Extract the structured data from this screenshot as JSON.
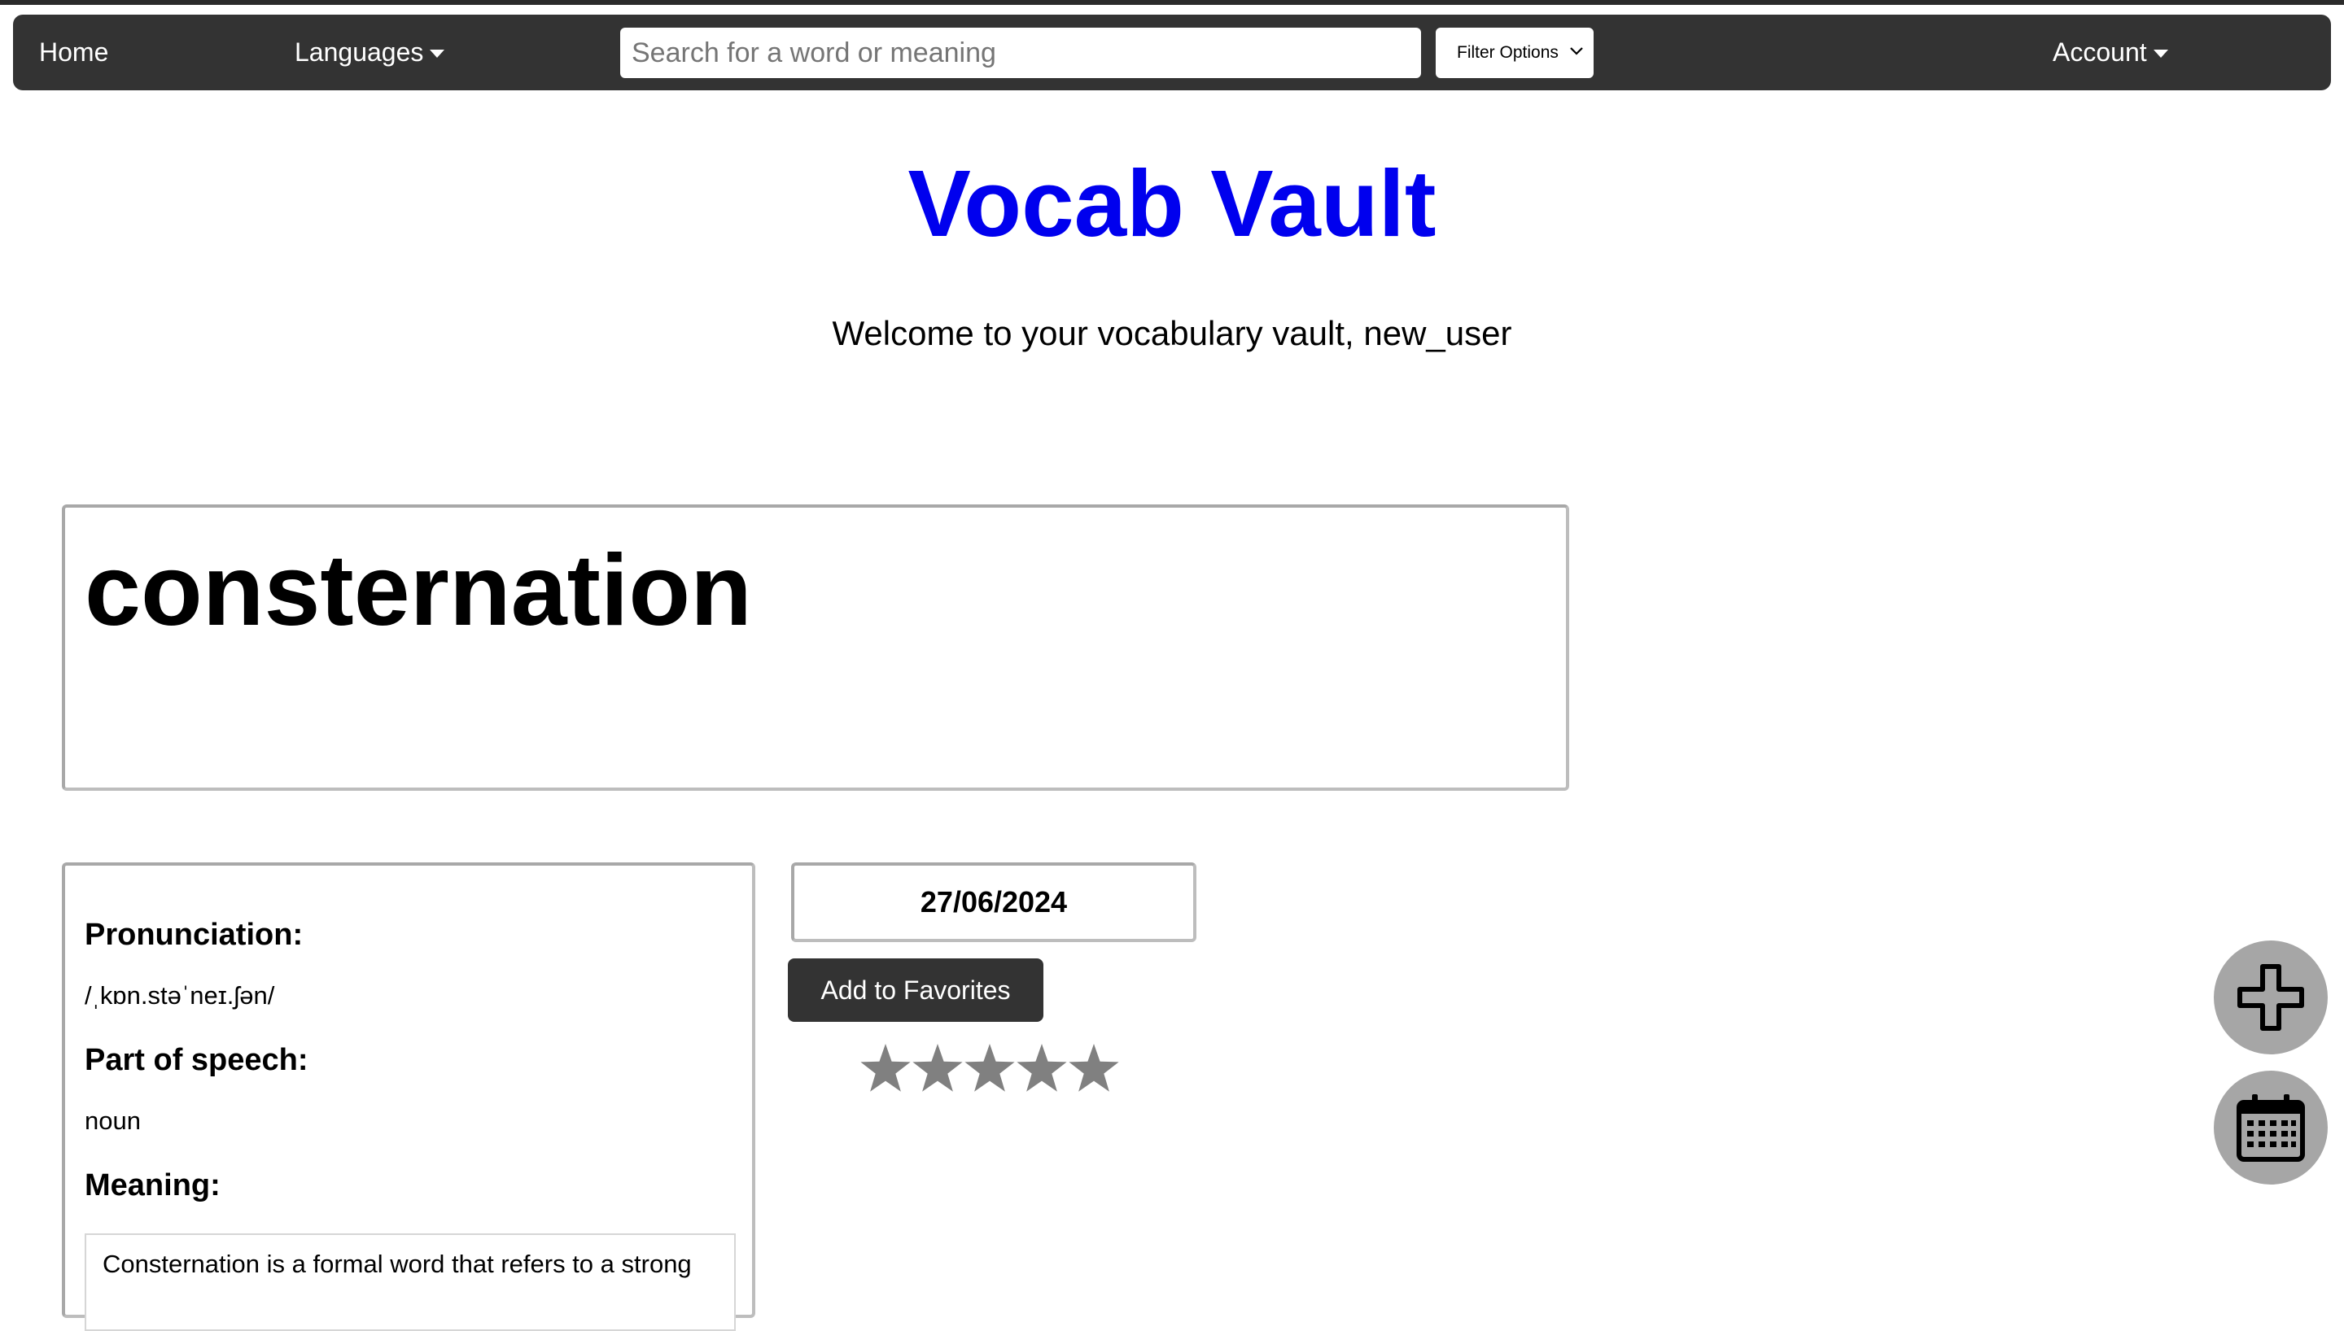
{
  "navbar": {
    "home_label": "Home",
    "languages_label": "Languages",
    "search_placeholder": "Search for a word or meaning",
    "filter_label": "Filter Options",
    "account_label": "Account"
  },
  "header": {
    "title": "Vocab Vault",
    "welcome": "Welcome to your vocabulary vault, new_user"
  },
  "word": {
    "text": "consternation",
    "pronunciation_heading": "Pronunciation:",
    "pronunciation": "/ˌkɒn.stəˈneɪ.ʃən/",
    "part_of_speech_heading": "Part of speech:",
    "part_of_speech": "noun",
    "meaning_heading": "Meaning:",
    "meaning": "Consternation is a formal word that refers to a strong"
  },
  "entry": {
    "date": "27/06/2024",
    "favorite_button": "Add to Favorites",
    "rating": 0,
    "max_rating": 5
  },
  "fabs": {
    "add_icon": "plus-icon",
    "calendar_icon": "calendar-icon"
  },
  "colors": {
    "navbar_bg": "#333333",
    "title": "#0000ee",
    "star": "#808080",
    "fab_bg": "#a6a6a6"
  }
}
